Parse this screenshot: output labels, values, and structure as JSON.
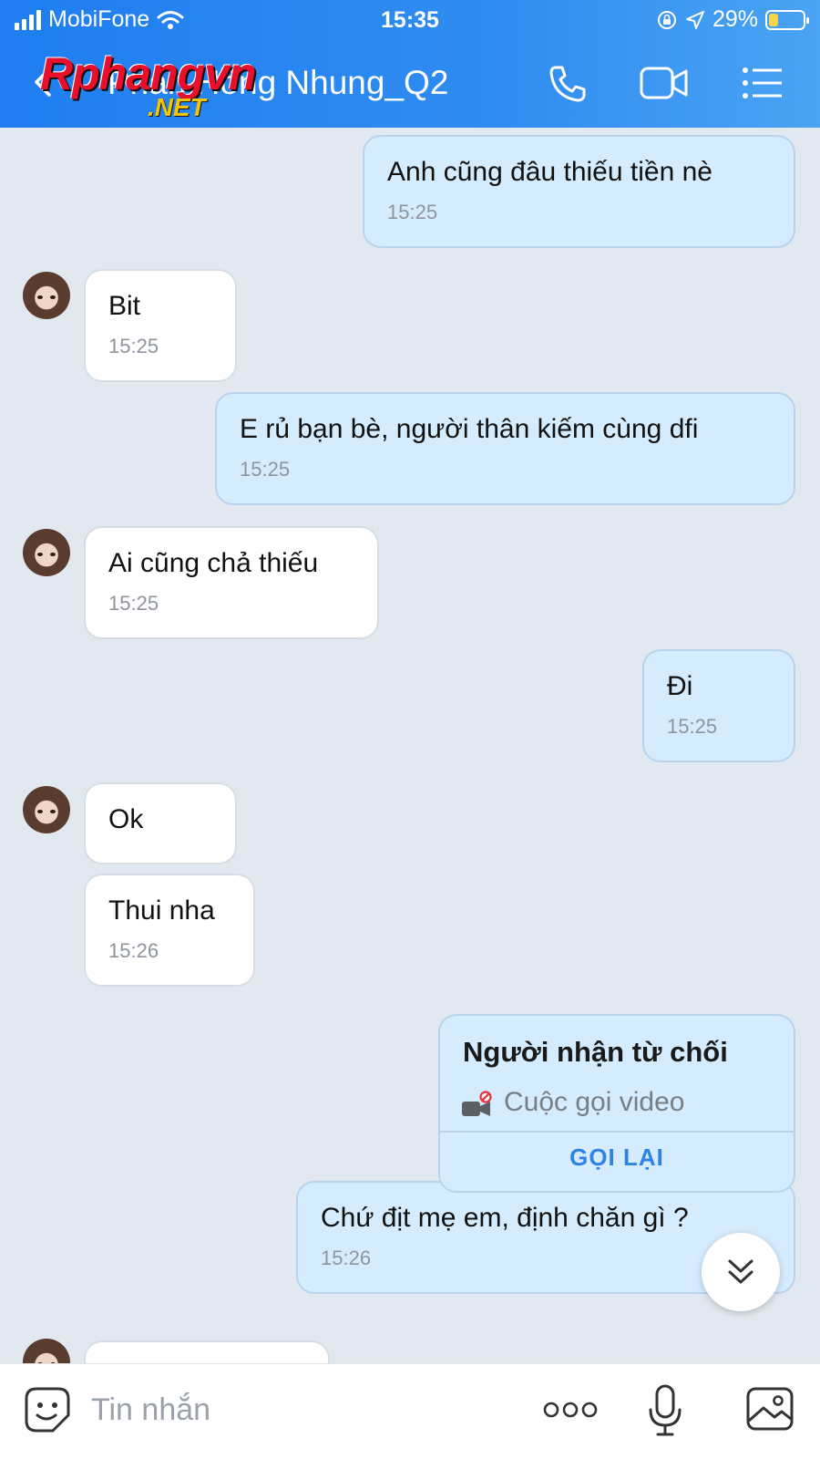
{
  "status_bar": {
    "carrier": "MobiFone",
    "time": "15:35",
    "battery": "29%"
  },
  "header": {
    "title": "Phan Hồng Nhung_Q2"
  },
  "watermark": {
    "line1": "Rphangvn",
    "line2": ".NET"
  },
  "messages": [
    {
      "text": "Anh cũng đâu thiếu tiền nè",
      "time": "15:25"
    },
    {
      "text": "Bit",
      "time": "15:25"
    },
    {
      "text": "E rủ bạn bè, người thân kiếm cùng dfi",
      "time": "15:25"
    },
    {
      "text": "Ai cũng chả thiếu",
      "time": "15:25"
    },
    {
      "text": "Đi",
      "time": "15:25"
    },
    {
      "text": "Ok"
    },
    {
      "text": "Thui nha",
      "time": "15:26"
    },
    {
      "text": "Chứ địt mẹ em, định chăn gì ?",
      "time": "15:26"
    }
  ],
  "call_card": {
    "title": "Người nhận từ chối",
    "subtitle": "Cuộc gọi video",
    "action": "GỌI LẠI"
  },
  "composer": {
    "placeholder": "Tin nhắn"
  },
  "colors": {
    "header": "#2f8cf0",
    "outgoing_bubble": "#d5ecfe",
    "incoming_bubble": "#ffffff",
    "background": "#e2e8f0",
    "accent": "#2f82e6"
  },
  "icons": [
    "back-icon",
    "phone-icon",
    "video-call-icon",
    "menu-icon",
    "scroll-down-icon",
    "sticker-icon",
    "more-icon",
    "microphone-icon",
    "image-icon"
  ]
}
